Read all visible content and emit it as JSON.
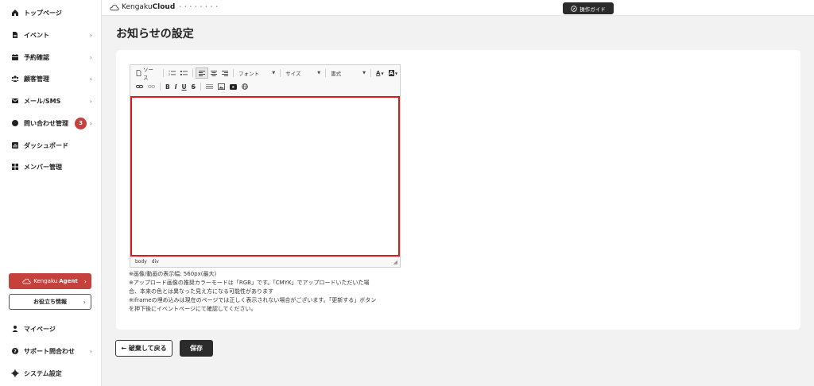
{
  "sidebar": {
    "items": [
      {
        "label": "トップページ",
        "icon": "home-icon",
        "chevron": false
      },
      {
        "label": "イベント",
        "icon": "document-icon",
        "chevron": true
      },
      {
        "label": "予約確認",
        "icon": "calendar-icon",
        "chevron": true
      },
      {
        "label": "顧客管理",
        "icon": "users-icon",
        "chevron": true
      },
      {
        "label": "メール/SMS",
        "icon": "mail-icon",
        "chevron": true
      },
      {
        "label": "問い合わせ管理",
        "icon": "chat-icon",
        "chevron": true,
        "badge": "3"
      },
      {
        "label": "ダッシュボード",
        "icon": "chart-icon",
        "chevron": false
      },
      {
        "label": "メンバー管理",
        "icon": "grid-icon",
        "chevron": false
      }
    ],
    "agent_button": {
      "brand": "Kengaku",
      "brand_bold": "Agent"
    },
    "info_button": "お役立ち情報",
    "bottom_items": [
      {
        "label": "マイページ",
        "icon": "person-icon",
        "chevron": false
      },
      {
        "label": "サポート問合わせ",
        "icon": "help-icon",
        "chevron": true
      },
      {
        "label": "システム設定",
        "icon": "gear-icon",
        "chevron": false
      }
    ],
    "accent": "#c5413b"
  },
  "header": {
    "logo_regular": "Kengaku",
    "logo_bold": "Cloud",
    "logo_tagline": "• • • • • • • •",
    "guide_button": "操作ガイド"
  },
  "main": {
    "title": "お知らせの設定",
    "toolbar": {
      "source_label": "ソース",
      "font_label": "フォント",
      "size_label": "サイズ",
      "format_label": "書式",
      "bold": "B",
      "italic": "I",
      "underline": "U",
      "strike": "S",
      "text_color": "A",
      "bg_color": "A"
    },
    "statusbar": {
      "tag1": "body",
      "tag2": "div"
    },
    "notes": [
      "※画像/動画の表示幅: 560px(最大)",
      "※アップロード画像の推奨カラーモードは「RGB」です。「CMYK」でアップロードいただいた場",
      "合、本来の色とは異なった見え方になる可能性があります",
      "※iframeの埋め込みは現在のページでは正しく表示されない場合がございます。「更新する」ボタン",
      "を押下後にイベントページにて確認してください。"
    ],
    "back_button": "← 破棄して戻る",
    "save_button": "保存"
  }
}
